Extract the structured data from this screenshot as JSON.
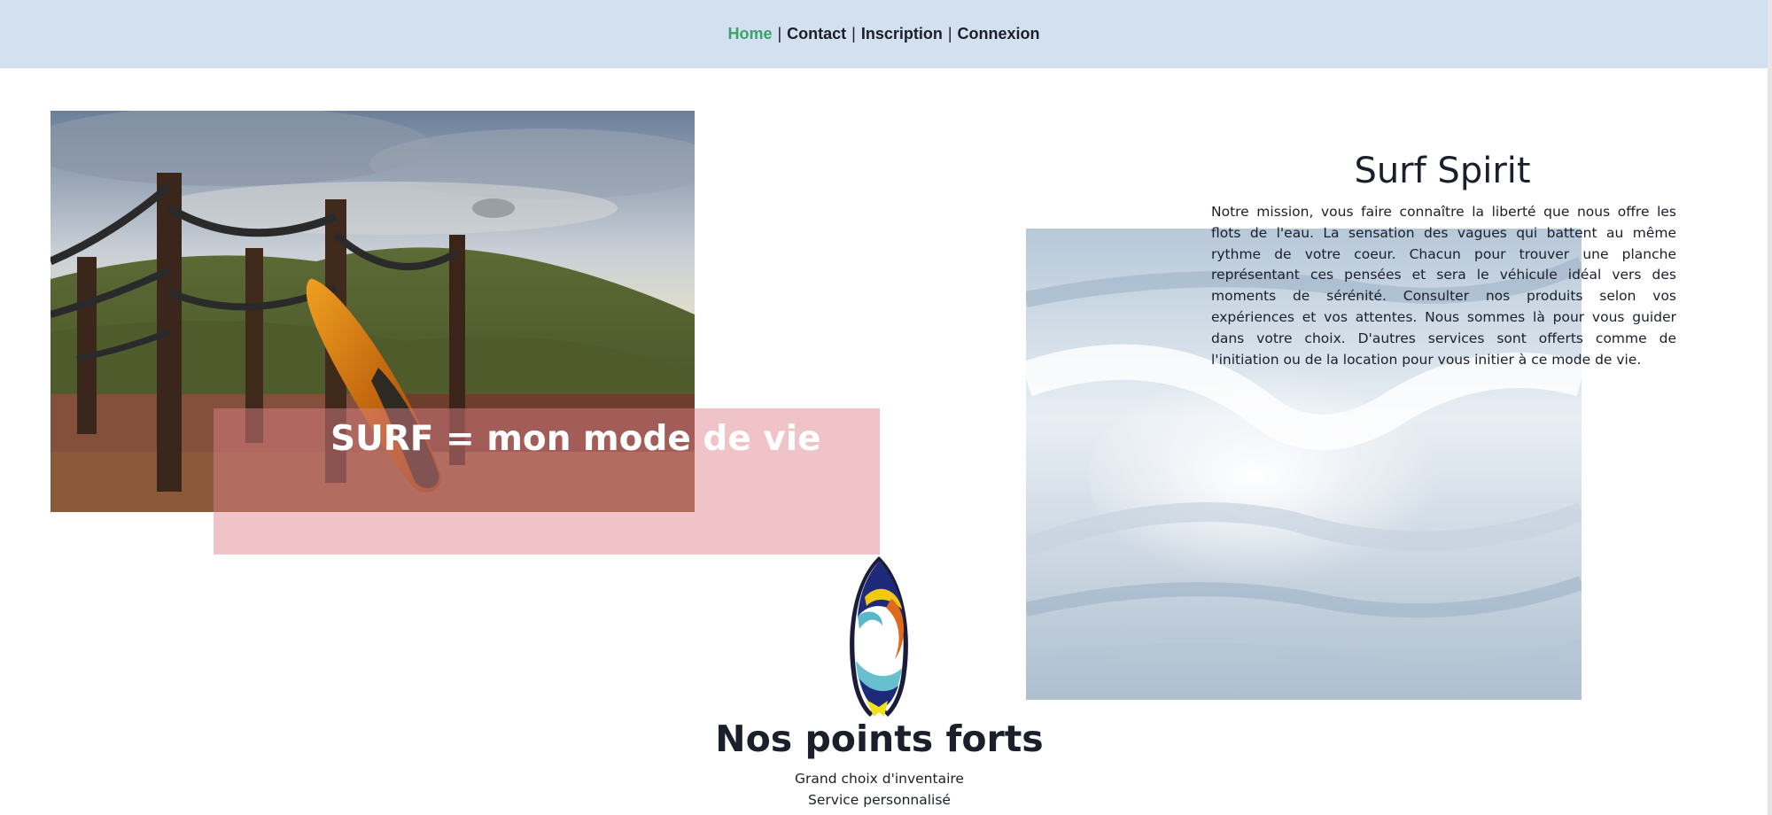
{
  "nav": {
    "items": [
      {
        "label": "Home",
        "active": true
      },
      {
        "label": "Contact",
        "active": false
      },
      {
        "label": "Inscription",
        "active": false
      },
      {
        "label": "Connexion",
        "active": false
      }
    ],
    "separator": "|",
    "active_color": "#3aa36b",
    "bar_color": "#d2e0ef"
  },
  "hero": {
    "slogan": "SURF = mon mode de vie",
    "overlay_color": "#dd828a"
  },
  "about": {
    "title": "Surf Spirit",
    "text": "Notre mission, vous faire connaître la liberté que nous offre les flots de l'eau. La sensation des vagues qui battent au même rythme de votre coeur. Chacun pour trouver une planche représentant ces pensées et sera le véhicule idéal vers des moments de sérénité. Consulter nos produits selon vos expériences et vos attentes. Nous sommes là pour vous guider dans votre choix. D'autres services sont offerts comme de l'initiation ou de la location pour vous initier à ce mode de vie."
  },
  "strengths": {
    "title": "Nos points forts",
    "items": [
      "Grand choix d'inventaire",
      "Service personnalisé"
    ]
  },
  "icons": {
    "logo": "surfboard-logo-icon"
  }
}
